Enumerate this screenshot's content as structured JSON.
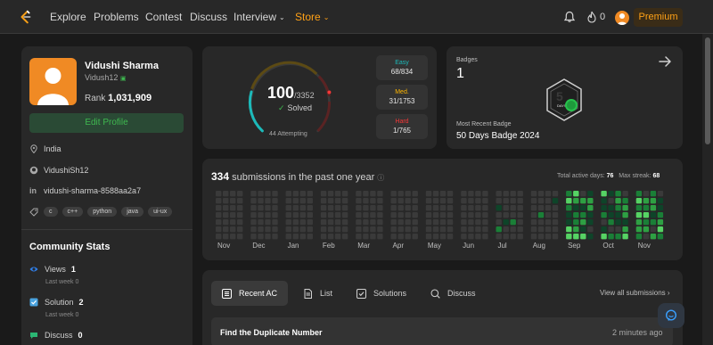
{
  "nav": {
    "items": [
      "Explore",
      "Problems",
      "Contest",
      "Discuss",
      "Interview",
      "Store"
    ],
    "streak": "0",
    "premium": "Premium"
  },
  "profile": {
    "name": "Vidushi Sharma",
    "handle": "Vidush12",
    "rank_label": "Rank",
    "rank": "1,031,909",
    "edit_label": "Edit Profile",
    "location": "India",
    "github": "VidushiSh12",
    "linkedin": "vidushi-sharma-8588aa2a7",
    "tags": [
      "c",
      "c++",
      "python",
      "java",
      "ui-ux"
    ]
  },
  "community": {
    "title": "Community Stats",
    "stats": [
      {
        "label": "Views",
        "value": "1",
        "sub": "Last week 0",
        "color": "#2f80ed"
      },
      {
        "label": "Solution",
        "value": "2",
        "sub": "Last week 0",
        "color": "#4aa3df"
      },
      {
        "label": "Discuss",
        "value": "0",
        "sub": "",
        "color": "#2bb673"
      }
    ]
  },
  "solved": {
    "count": "100",
    "total": "/3352",
    "label": "Solved",
    "attempting": "44 Attempting",
    "difficulties": [
      {
        "label": "Easy",
        "value": "68/834",
        "color": "#1cbaba"
      },
      {
        "label": "Med.",
        "value": "31/1753",
        "color": "#ffb700"
      },
      {
        "label": "Hard",
        "value": "1/765",
        "color": "#f63737"
      }
    ]
  },
  "badges": {
    "title": "Badges",
    "count": "1",
    "recent_label": "Most Recent Badge",
    "recent_name": "50 Days Badge 2024",
    "badge_text": "DAYS"
  },
  "submissions": {
    "count": "334",
    "title_rest": "submissions in the past one year",
    "active_label": "Total active days:",
    "active_value": "76",
    "streak_label": "Max streak:",
    "streak_value": "68",
    "months": [
      "Nov",
      "Dec",
      "Jan",
      "Feb",
      "Mar",
      "Apr",
      "May",
      "Jun",
      "Jul",
      "Aug",
      "Sep",
      "Oct",
      "Nov"
    ]
  },
  "recent": {
    "tabs": [
      "Recent AC",
      "List",
      "Solutions",
      "Discuss"
    ],
    "view_all": "View all submissions",
    "items": [
      {
        "title": "Find the Duplicate Number",
        "time": "2 minutes ago"
      }
    ]
  },
  "colors": {
    "accent": "#ffa116",
    "green": "#3fb950",
    "heat_empty": "#3a3a3a",
    "heat_levels": [
      "#0e4429",
      "#1a7f37",
      "#2ea043",
      "#56d364"
    ]
  }
}
